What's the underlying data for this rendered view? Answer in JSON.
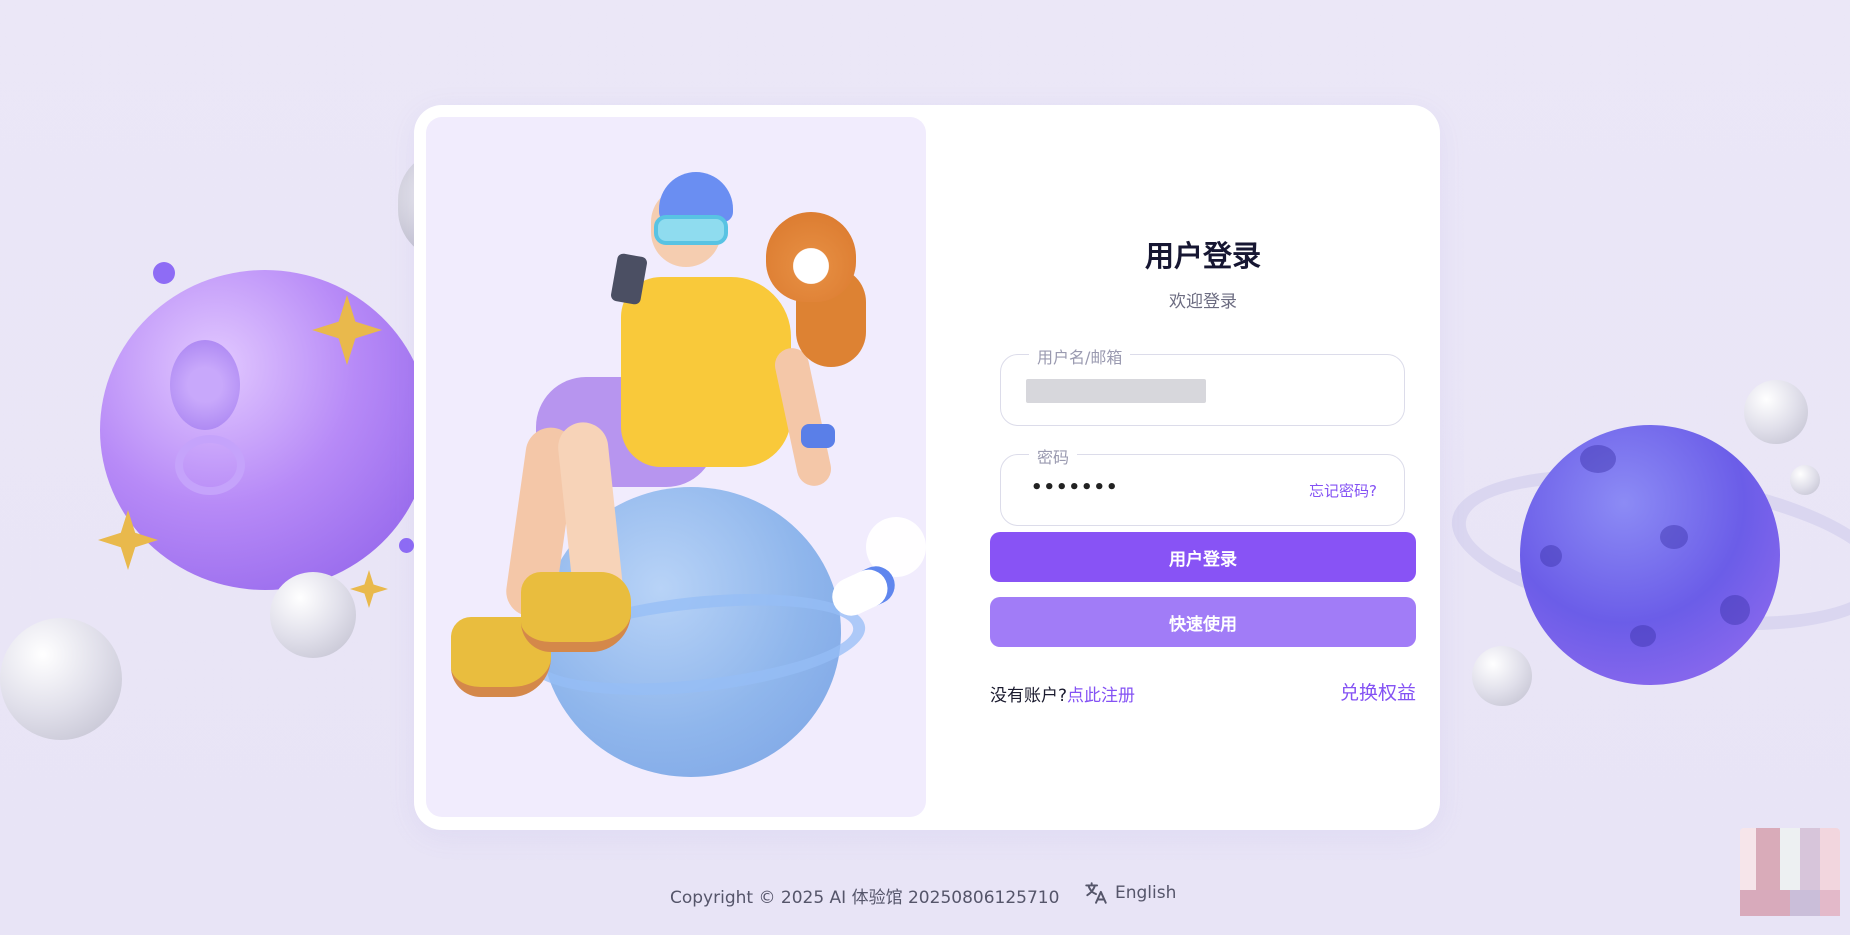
{
  "login": {
    "title": "用户登录",
    "subtitle": "欢迎登录",
    "username_label": "用户名/邮箱",
    "password_label": "密码",
    "password_value": "•••••••",
    "forgot_password": "忘记密码?",
    "login_button": "用户登录",
    "quick_use_button": "快速使用",
    "no_account_text": "没有账户?",
    "register_link": "点此注册",
    "redeem_link": "兑换权益"
  },
  "footer": {
    "copyright": "Copyright © 2025 AI 体验馆 20250806125710",
    "language": "English"
  },
  "colors": {
    "accent": "#8853f5",
    "accent_light": "#a17cf7",
    "background": "#ebe7f7"
  },
  "icons": {
    "language": "translate-icon"
  }
}
